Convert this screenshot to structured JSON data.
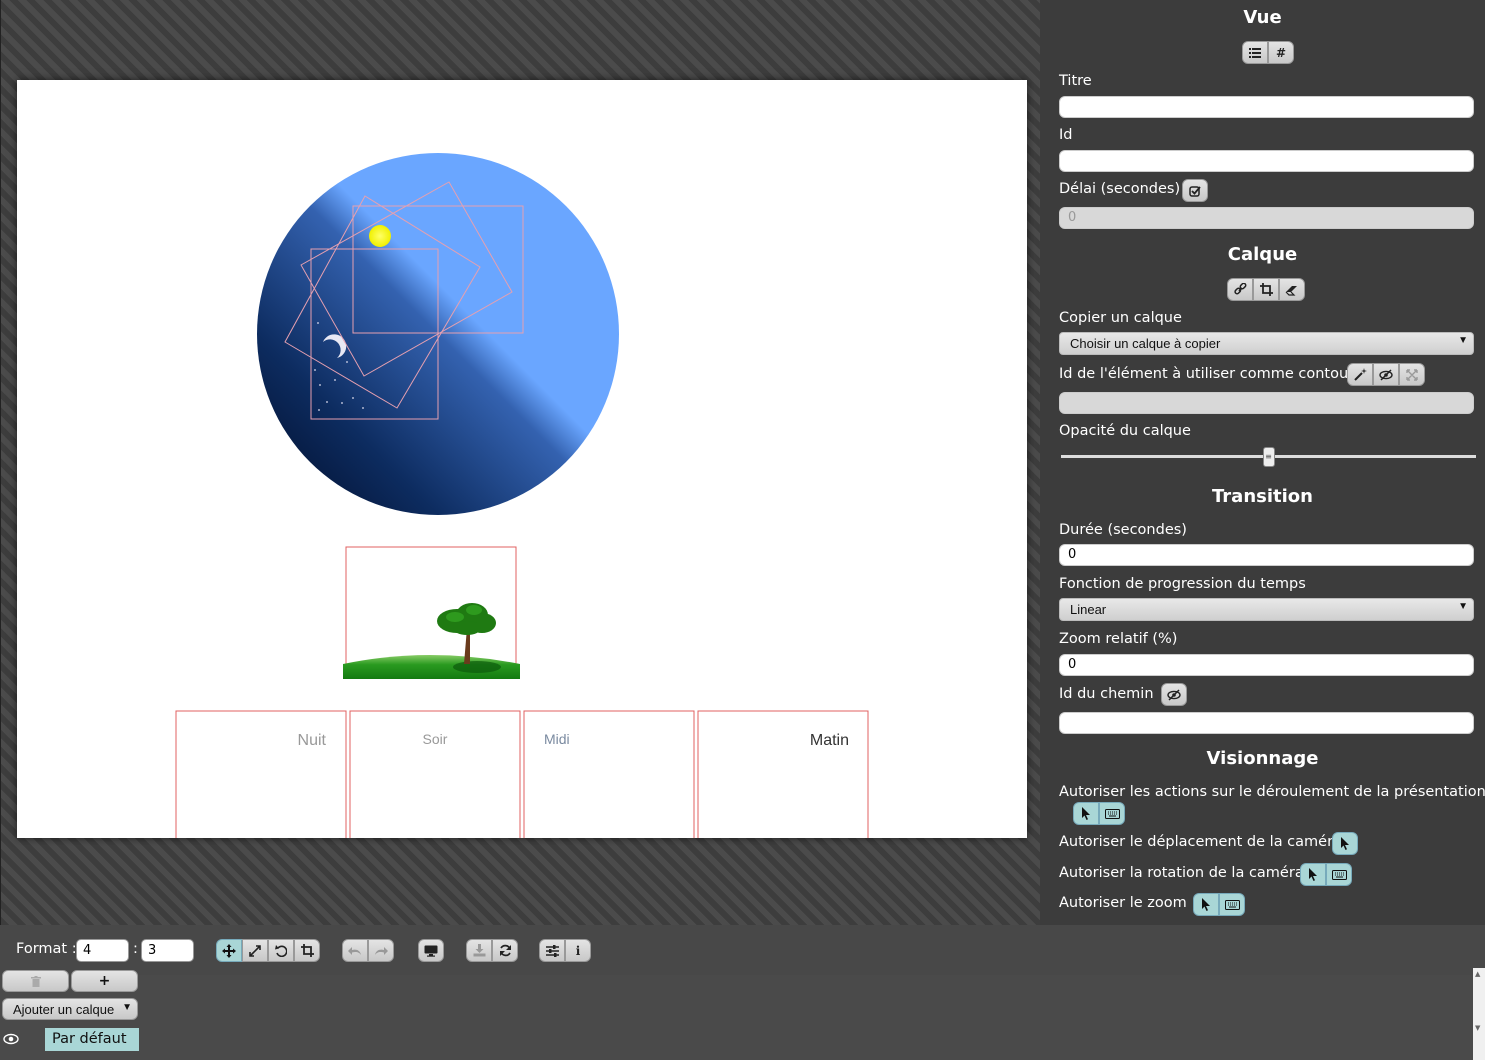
{
  "slide": {
    "frames": [
      {
        "label": "Nuit",
        "color": "#999999"
      },
      {
        "label": "Soir",
        "color": "#999999"
      },
      {
        "label": "Midi",
        "color": "#7a8aa0"
      },
      {
        "label": "Matin",
        "color": "#333333"
      }
    ]
  },
  "panel": {
    "vue": {
      "title": "Vue",
      "icons": [
        "list-icon",
        "hash-icon"
      ],
      "titre_label": "Titre",
      "titre_value": "",
      "id_label": "Id",
      "id_value": "",
      "delai_label": "Délai (secondes)",
      "delai_placeholder": "0"
    },
    "calque": {
      "title": "Calque",
      "icons": [
        "link-icon",
        "crop-icon",
        "eraser-icon"
      ],
      "copier_label": "Copier un calque",
      "copier_select": "Choisir un calque à copier",
      "contour_label": "Id de l'élément à utiliser comme contour",
      "contour_value": "",
      "opacite_label": "Opacité du calque",
      "opacite_value": 0.5
    },
    "transition": {
      "title": "Transition",
      "duree_label": "Durée (secondes)",
      "duree_value": "0",
      "fonction_label": "Fonction de progression du temps",
      "fonction_select": "Linear",
      "zoom_label": "Zoom relatif (%)",
      "zoom_value": "0",
      "chemin_label": "Id du chemin",
      "chemin_value": ""
    },
    "visionnage": {
      "title": "Visionnage",
      "actions_label": "Autoriser les actions sur le déroulement de la présentation",
      "camera_label": "Autoriser le déplacement de la caméra",
      "rotation_label": "Autoriser la rotation de la caméra",
      "zoom_label": "Autoriser le zoom"
    }
  },
  "toolbar": {
    "format_label": "Format :",
    "format_w": "4",
    "colon": ":",
    "format_h": "3"
  },
  "layers": {
    "add_select": "Ajouter un calque",
    "add_button": "+",
    "items": [
      {
        "label": "Par défaut"
      }
    ]
  },
  "colors": {
    "accent": "#a9d6d6",
    "frame_stroke": "#e06060",
    "sphere_light": "#6aa6ff",
    "sphere_dark": "#001030"
  }
}
